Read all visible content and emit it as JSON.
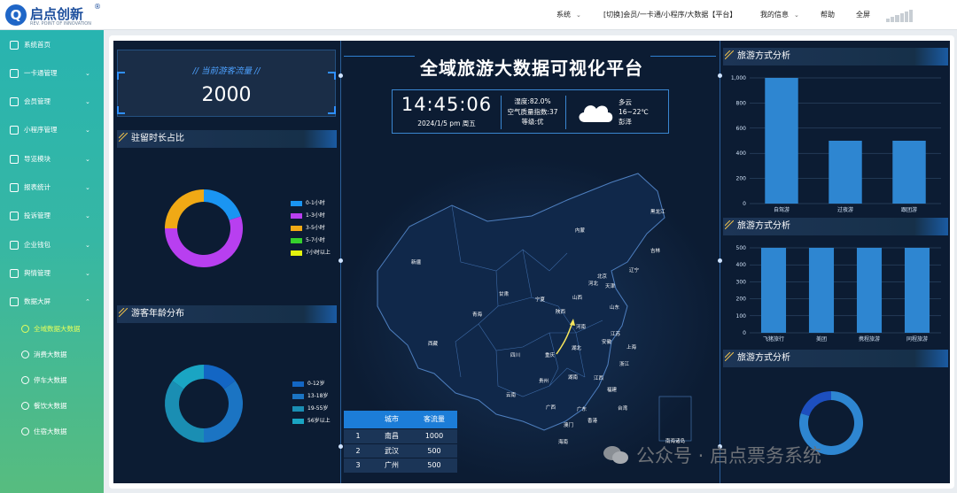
{
  "header": {
    "brand": "启点创新",
    "brand_sub": "REV. POINT OF INNOVATION",
    "brand_reg": "®",
    "nav": [
      {
        "label": "系统",
        "dropdown": true
      },
      {
        "label": "[切换]会员/一卡通/小程序/大数据【平台】",
        "dropdown": false
      },
      {
        "label": "我的信息",
        "dropdown": true
      },
      {
        "label": "帮助",
        "dropdown": false
      },
      {
        "label": "全屏",
        "dropdown": false
      }
    ]
  },
  "sidebar": {
    "items": [
      {
        "label": "系统首页",
        "icon": "home-icon",
        "arrow": ""
      },
      {
        "label": "一卡通管理",
        "icon": "card-icon",
        "arrow": "⌄"
      },
      {
        "label": "会员管理",
        "icon": "user-icon",
        "arrow": "⌄"
      },
      {
        "label": "小程序管理",
        "icon": "miniapp-icon",
        "arrow": "⌄"
      },
      {
        "label": "导览模块",
        "icon": "navigation-icon",
        "arrow": "⌄"
      },
      {
        "label": "报表统计",
        "icon": "bar-chart-icon",
        "arrow": "⌄"
      },
      {
        "label": "投诉管理",
        "icon": "complaint-icon",
        "arrow": "⌄"
      },
      {
        "label": "企业钱包",
        "icon": "wallet-icon",
        "arrow": "⌄"
      },
      {
        "label": "舆情管理",
        "icon": "opinion-icon",
        "arrow": "⌄"
      },
      {
        "label": "数据大屏",
        "icon": "data-screen-icon",
        "arrow": "⌃"
      }
    ],
    "subitems": [
      {
        "label": "全域数据大数据",
        "icon": "chart-icon",
        "active": true
      },
      {
        "label": "消费大数据",
        "icon": "consume-icon",
        "active": false
      },
      {
        "label": "停车大数据",
        "icon": "parking-icon",
        "active": false
      },
      {
        "label": "餐饮大数据",
        "icon": "dining-icon",
        "active": false
      },
      {
        "label": "住宿大数据",
        "icon": "lodging-icon",
        "active": false
      }
    ]
  },
  "dashboard": {
    "title": "全域旅游大数据可视化平台",
    "visitor": {
      "title": "// 当前游客流量 //",
      "value": "2000"
    },
    "time": "14:45:06",
    "date": "2024/1/5  pm  周五",
    "env": {
      "humidity": "湿度:82.0%",
      "aqi": "空气质量指数:37",
      "level": "等级:优"
    },
    "weather": {
      "desc": "多云",
      "temp": "16~22℃",
      "city": "彭泽",
      "icon": "cloud-icon"
    },
    "panels": {
      "stay": "驻留时长占比",
      "age": "游客年龄分布",
      "travel1": "旅游方式分析",
      "travel2": "旅游方式分析",
      "travel3": "旅游方式分析"
    },
    "city_table": {
      "headers": [
        "",
        "城市",
        "客流量"
      ],
      "rows": [
        [
          "1",
          "南昌",
          "1000"
        ],
        [
          "2",
          "武汉",
          "500"
        ],
        [
          "3",
          "广州",
          "500"
        ]
      ]
    },
    "map_cities": [
      {
        "name": "黑龙江"
      },
      {
        "name": "吉林"
      },
      {
        "name": "辽宁"
      },
      {
        "name": "内蒙"
      },
      {
        "name": "新疆"
      },
      {
        "name": "北京"
      },
      {
        "name": "天津"
      },
      {
        "name": "河北"
      },
      {
        "name": "山西"
      },
      {
        "name": "山东"
      },
      {
        "name": "甘肃"
      },
      {
        "name": "宁夏"
      },
      {
        "name": "青海"
      },
      {
        "name": "陕西"
      },
      {
        "name": "河南"
      },
      {
        "name": "江苏"
      },
      {
        "name": "安徽"
      },
      {
        "name": "上海"
      },
      {
        "name": "西藏"
      },
      {
        "name": "四川"
      },
      {
        "name": "重庆"
      },
      {
        "name": "湖北"
      },
      {
        "name": "浙江"
      },
      {
        "name": "贵州"
      },
      {
        "name": "湖南"
      },
      {
        "name": "江西"
      },
      {
        "name": "福建"
      },
      {
        "name": "云南"
      },
      {
        "name": "广西"
      },
      {
        "name": "广东"
      },
      {
        "name": "台湾"
      },
      {
        "name": "香港"
      },
      {
        "name": "澳门"
      },
      {
        "name": "海南"
      },
      {
        "name": "南海诸岛"
      }
    ],
    "watermark": "公众号 · 启点票务系统"
  },
  "chart_data": [
    {
      "type": "pie",
      "title": "驻留时长占比",
      "categories": [
        "0-1小时",
        "1-3小时",
        "3-5小时",
        "5-7小时",
        "7小时以上"
      ],
      "values": [
        20,
        55,
        25,
        0,
        0
      ],
      "colors": [
        "#1a95f2",
        "#b83ff0",
        "#f0a915",
        "#35d02c",
        "#e3f20e"
      ]
    },
    {
      "type": "pie",
      "title": "游客年龄分布",
      "categories": [
        "0-12岁",
        "13-18岁",
        "19-55岁",
        "56岁以上"
      ],
      "values": [
        15,
        35,
        35,
        15
      ],
      "colors": [
        "#1366c4",
        "#1b74c3",
        "#1a8eb3",
        "#1aa5c3"
      ]
    },
    {
      "type": "bar",
      "title": "旅游方式分析",
      "categories": [
        "自驾游",
        "过夜游",
        "跟团游"
      ],
      "values": [
        1000,
        500,
        500
      ],
      "ylim": [
        0,
        1000
      ],
      "yticks": [
        0,
        200,
        400,
        600,
        800,
        1000
      ],
      "color": "#2e86d1"
    },
    {
      "type": "bar",
      "title": "旅游方式分析",
      "categories": [
        "飞猪旅行",
        "美团",
        "携程旅游",
        "同程旅游"
      ],
      "values": [
        500,
        500,
        500,
        500
      ],
      "ylim": [
        0,
        500
      ],
      "yticks": [
        0,
        100,
        200,
        300,
        400,
        500
      ],
      "color": "#2e86d1"
    },
    {
      "type": "pie",
      "title": "旅游方式分析",
      "categories": [
        "",
        ""
      ],
      "values": [
        80,
        20
      ],
      "colors": [
        "#2e86d1",
        "#1d4fbf"
      ]
    }
  ]
}
